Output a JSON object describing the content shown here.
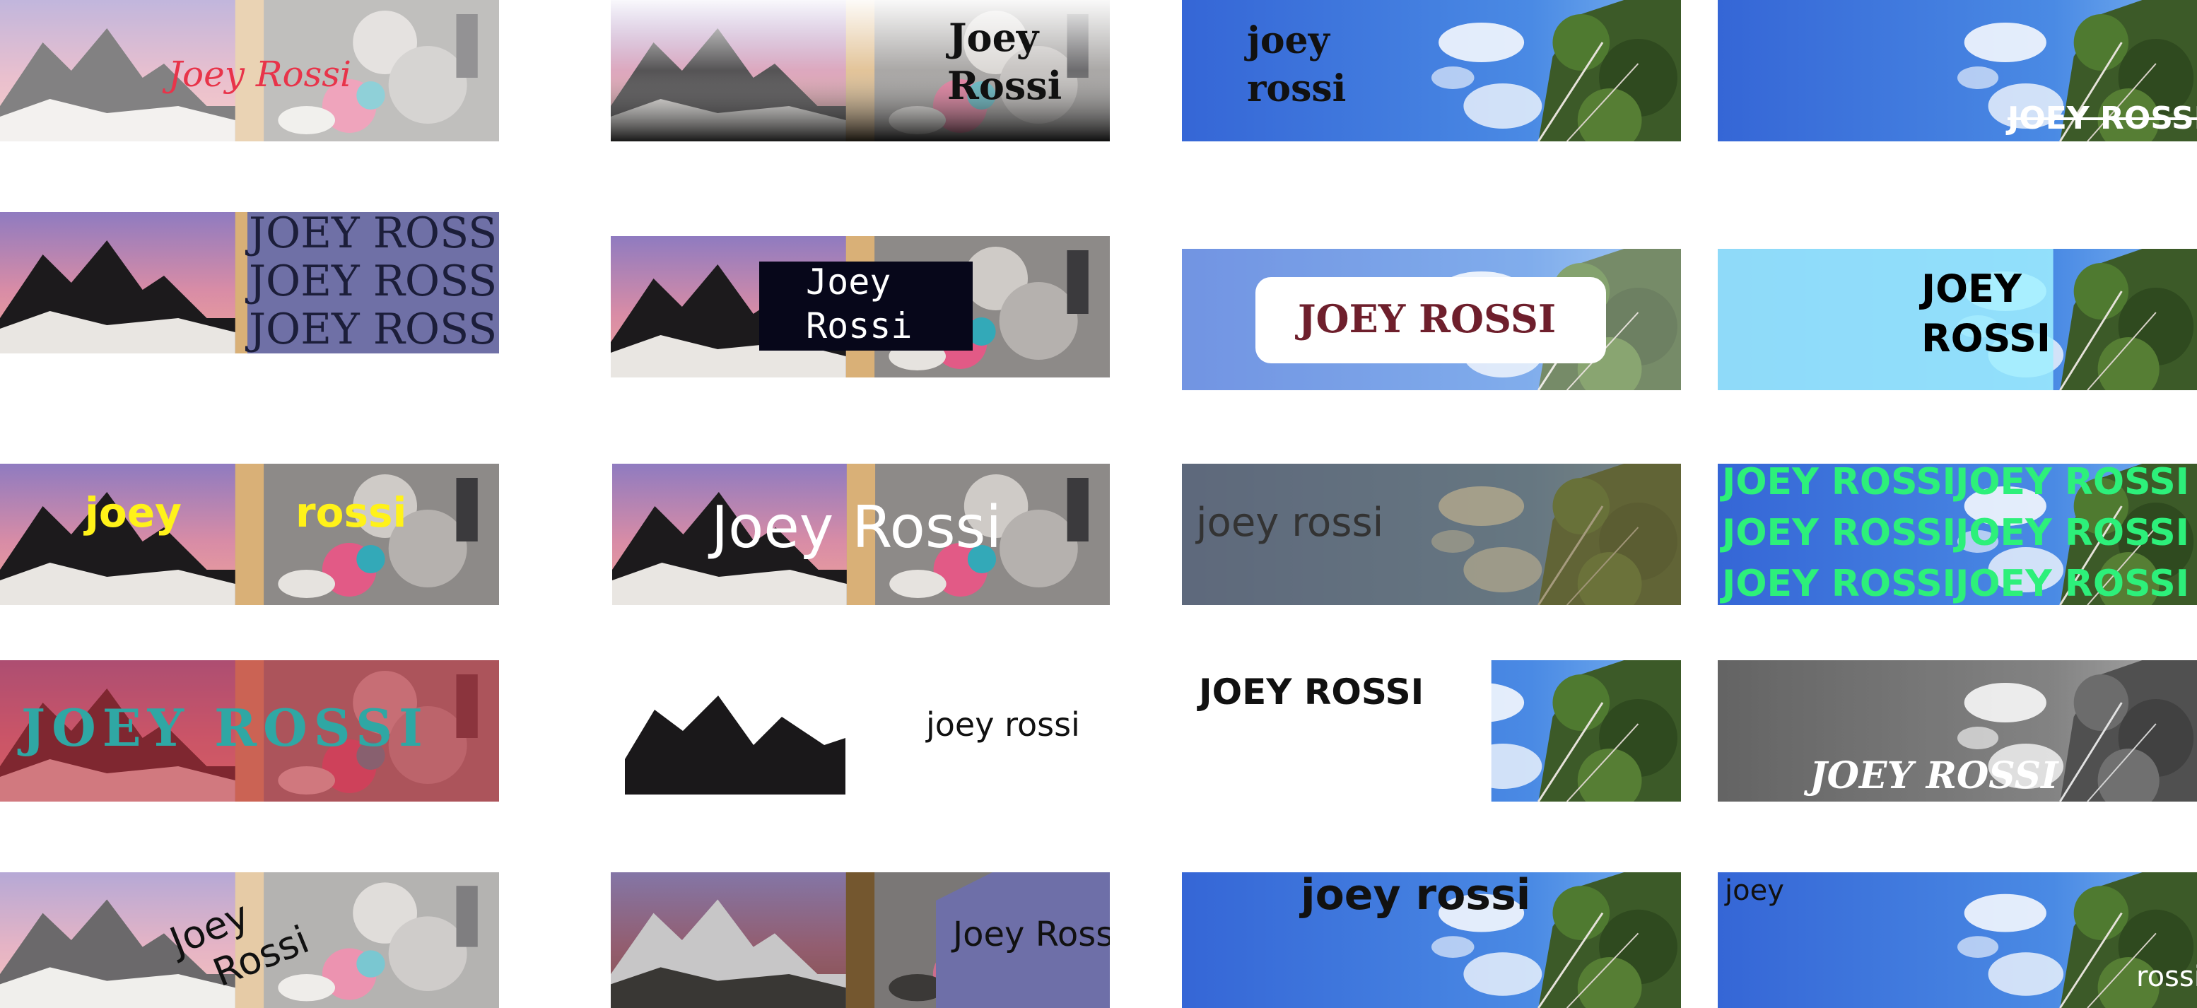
{
  "colors": {
    "page_bg": "#ffffff",
    "sky_blue": "#3a78dc",
    "sky_light": "#9ec8f2",
    "lavender": "#6e6fa8",
    "purple_slab": "#6f70a6",
    "maroon": "#6e1f2c",
    "mint": "#2df07a",
    "yellow": "#fff219",
    "teal": "#2fa7a4",
    "red_tint": "#c2303d",
    "pink": "#e8344a"
  },
  "tiles": {
    "r1c1": {
      "text": "Joey Rossi"
    },
    "r1c2": {
      "line1": "Joey",
      "line2": "Rossi"
    },
    "r1c3": {
      "line1": "joey",
      "line2": "rossi"
    },
    "r1c4": {
      "text": "JOEY ROSSI"
    },
    "r2c1": {
      "lines": [
        "JOEY ROSSI",
        "JOEY ROSSI",
        "JOEY ROSSI"
      ]
    },
    "r2c2": {
      "line1": "Joey",
      "line2": "Rossi"
    },
    "r2c3": {
      "text": "JOEY ROSSI"
    },
    "r2c4": {
      "line1": "JOEY",
      "line2": "ROSSI"
    },
    "r3c1": {
      "word1": "joey",
      "word2": "rossi"
    },
    "r3c2": {
      "text": "Joey Rossi"
    },
    "r3c3": {
      "text": "joey rossi"
    },
    "r3c4": {
      "cells": [
        "JOEY ROSSI",
        "JOEY ROSSI",
        "JOEY ROSSI",
        "JOEY ROSSI",
        "JOEY ROSSI",
        "JOEY ROSSI"
      ]
    },
    "r4c1": {
      "text": "JOEY ROSSI"
    },
    "r4c2": {
      "text": "joey rossi"
    },
    "r4c3": {
      "text": "JOEY ROSSI"
    },
    "r4c4": {
      "text": "JOEY ROSSI"
    },
    "r5c1": {
      "line1": "Joey",
      "line2": "Rossi"
    },
    "r5c2": {
      "text": "Joey Rossi"
    },
    "r5c3": {
      "text": "joey rossi"
    },
    "r5c4": {
      "line1": "joey",
      "line2": "rossi"
    }
  }
}
